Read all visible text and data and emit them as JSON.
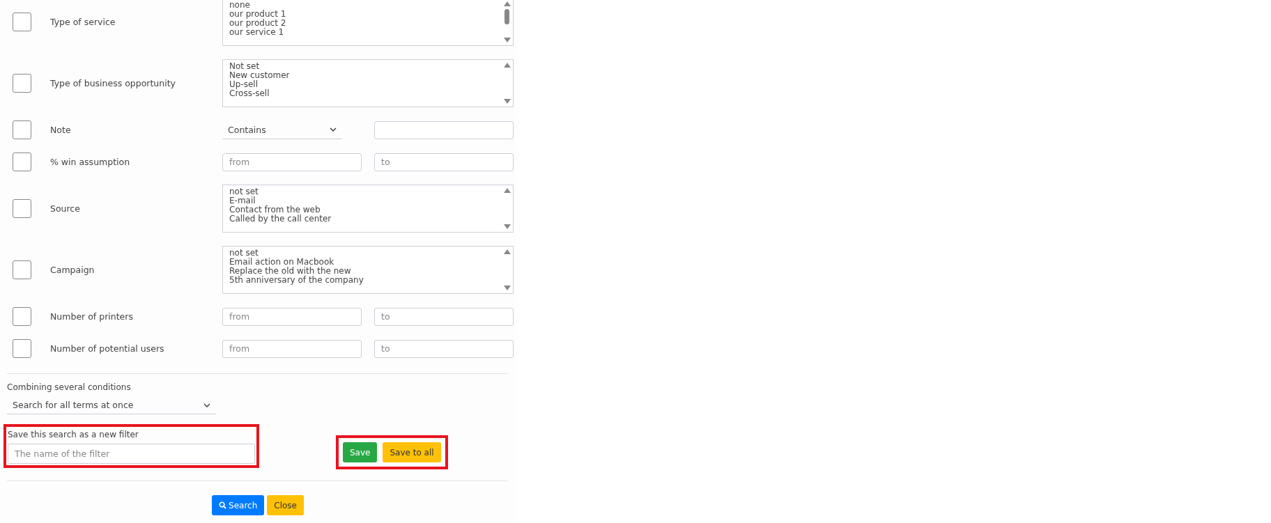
{
  "conditions": [
    {
      "kind": "listbox",
      "label": "Type of service",
      "checked": false,
      "scroll_thumb": true,
      "options": [
        "none",
        "our product 1",
        "our product 2",
        "our service 1"
      ]
    },
    {
      "kind": "listbox",
      "label": "Type of business opportunity",
      "checked": false,
      "scroll_thumb": false,
      "options": [
        "Not set",
        "New customer",
        "Up-sell",
        "Cross-sell"
      ]
    },
    {
      "kind": "text_match",
      "label": "Note",
      "checked": false,
      "operator": "Contains"
    },
    {
      "kind": "range",
      "label": "% win assumption",
      "checked": false,
      "from_placeholder": "from",
      "to_placeholder": "to"
    },
    {
      "kind": "listbox",
      "label": "Source",
      "checked": false,
      "scroll_thumb": false,
      "options": [
        "not set",
        "E-mail",
        "Contact from the web",
        "Called by the call center"
      ]
    },
    {
      "kind": "listbox",
      "label": "Campaign",
      "checked": false,
      "scroll_thumb": false,
      "options": [
        "not set",
        "Email action on Macbook",
        "Replace the old with the new",
        "5th anniversary of the company"
      ]
    },
    {
      "kind": "range",
      "label": "Number of printers",
      "checked": false,
      "from_placeholder": "from",
      "to_placeholder": "to"
    },
    {
      "kind": "range",
      "label": "Number of potential users",
      "checked": false,
      "from_placeholder": "from",
      "to_placeholder": "to"
    }
  ],
  "combining": {
    "label": "Combining several conditions",
    "value": "Search for all terms at once"
  },
  "save_filter": {
    "label": "Save this search as a new filter",
    "placeholder": "The name of the filter",
    "highlighted": true
  },
  "save_buttons": {
    "highlighted": true,
    "buttons": [
      {
        "kind": "success",
        "label": "Save"
      },
      {
        "kind": "warning",
        "label": "Save to all"
      }
    ]
  },
  "footer_buttons": [
    {
      "kind": "primary",
      "label": "Search"
    },
    {
      "kind": "warning",
      "label": "Close"
    }
  ]
}
